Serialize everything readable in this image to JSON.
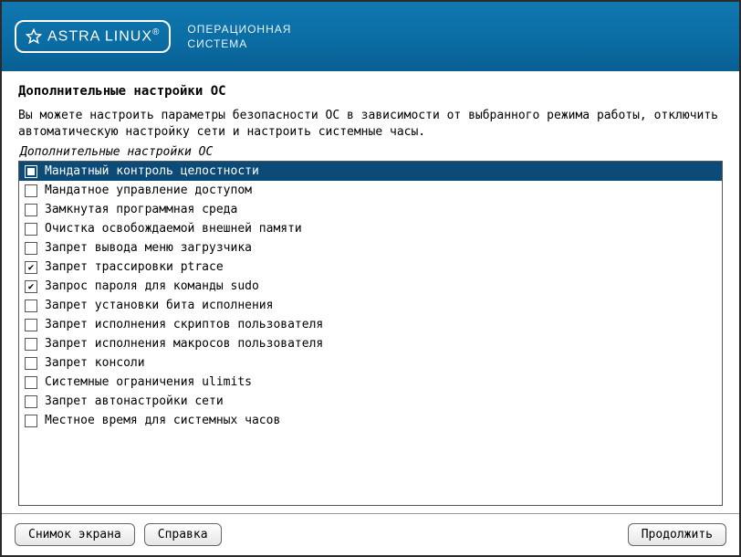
{
  "header": {
    "logo_text": "ASTRA LINUX",
    "logo_reg": "®",
    "caption_line1": "ОПЕРАЦИОННАЯ",
    "caption_line2": "СИСТЕМА"
  },
  "page": {
    "title": "Дополнительные настройки ОС",
    "description": "Вы можете настроить параметры безопасности ОС в зависимости от выбранного режима работы, отключить автоматическую настройку сети и настроить системные часы.",
    "section_label": "Дополнительные настройки ОС"
  },
  "options": [
    {
      "label": "Мандатный контроль целостности",
      "checked": false,
      "selected": true
    },
    {
      "label": "Мандатное управление доступом",
      "checked": false,
      "selected": false
    },
    {
      "label": "Замкнутая программная среда",
      "checked": false,
      "selected": false
    },
    {
      "label": "Очистка освобождаемой внешней памяти",
      "checked": false,
      "selected": false
    },
    {
      "label": "Запрет вывода меню загрузчика",
      "checked": false,
      "selected": false
    },
    {
      "label": "Запрет трассировки ptrace",
      "checked": true,
      "selected": false
    },
    {
      "label": "Запрос пароля для команды sudo",
      "checked": true,
      "selected": false
    },
    {
      "label": "Запрет установки бита исполнения",
      "checked": false,
      "selected": false
    },
    {
      "label": "Запрет исполнения скриптов пользователя",
      "checked": false,
      "selected": false
    },
    {
      "label": "Запрет исполнения макросов пользователя",
      "checked": false,
      "selected": false
    },
    {
      "label": "Запрет консоли",
      "checked": false,
      "selected": false
    },
    {
      "label": "Системные ограничения ulimits",
      "checked": false,
      "selected": false
    },
    {
      "label": "Запрет автонастройки сети",
      "checked": false,
      "selected": false
    },
    {
      "label": "Местное время для системных часов",
      "checked": false,
      "selected": false
    }
  ],
  "footer": {
    "screenshot": "Снимок экрана",
    "help": "Справка",
    "continue": "Продолжить"
  }
}
